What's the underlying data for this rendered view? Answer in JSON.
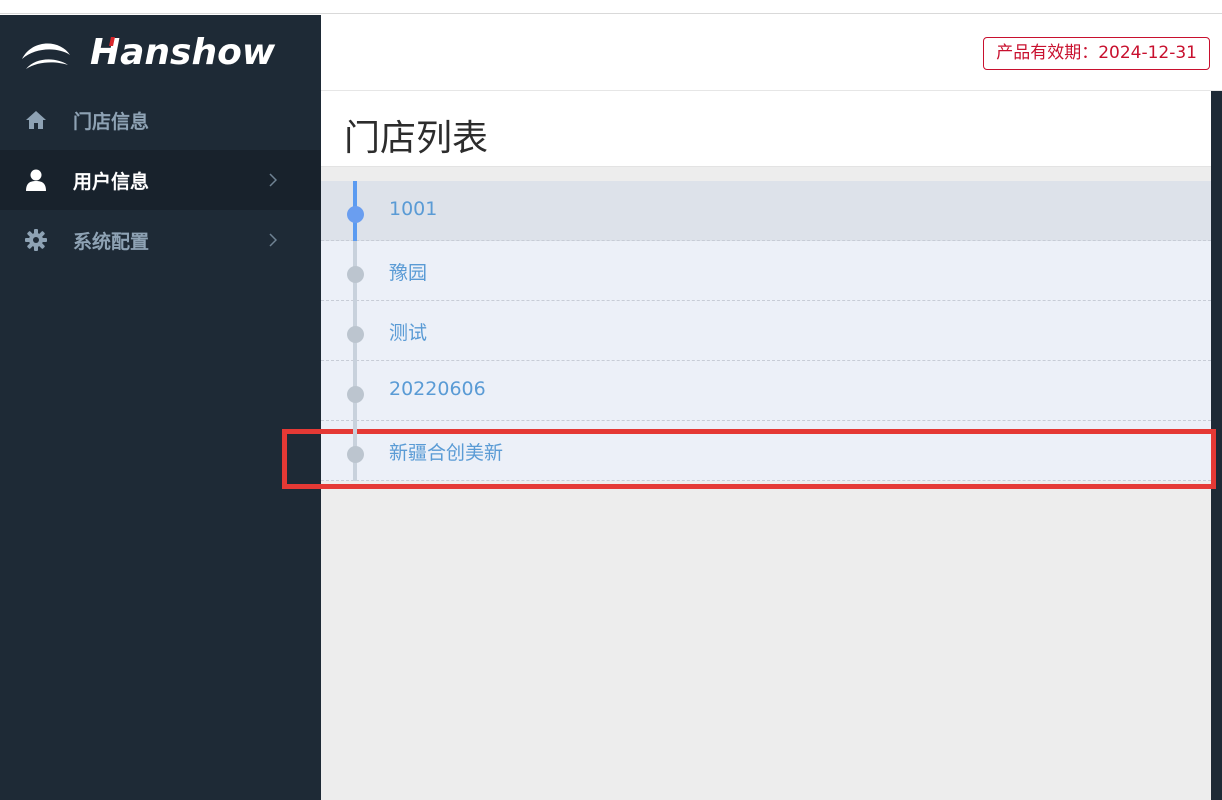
{
  "brand": {
    "name": "Hanshow"
  },
  "sidebar": {
    "items": [
      {
        "label": "门店信息",
        "icon": "home-icon",
        "has_chevron": false
      },
      {
        "label": "用户信息",
        "icon": "user-icon",
        "has_chevron": true
      },
      {
        "label": "系统配置",
        "icon": "gear-icon",
        "has_chevron": true
      }
    ]
  },
  "header": {
    "expiry_text": "产品有效期：2024-12-31"
  },
  "main": {
    "title": "门店列表",
    "stores": [
      {
        "name": "1001"
      },
      {
        "name": "豫园"
      },
      {
        "name": "测试"
      },
      {
        "name": "20220606"
      },
      {
        "name": "新疆合创美新"
      }
    ]
  },
  "colors": {
    "sidebar_bg": "#1e2a36",
    "accent_blue": "#5b9bf1",
    "expiry_red": "#c8102e",
    "highlight_red": "#e53935"
  }
}
